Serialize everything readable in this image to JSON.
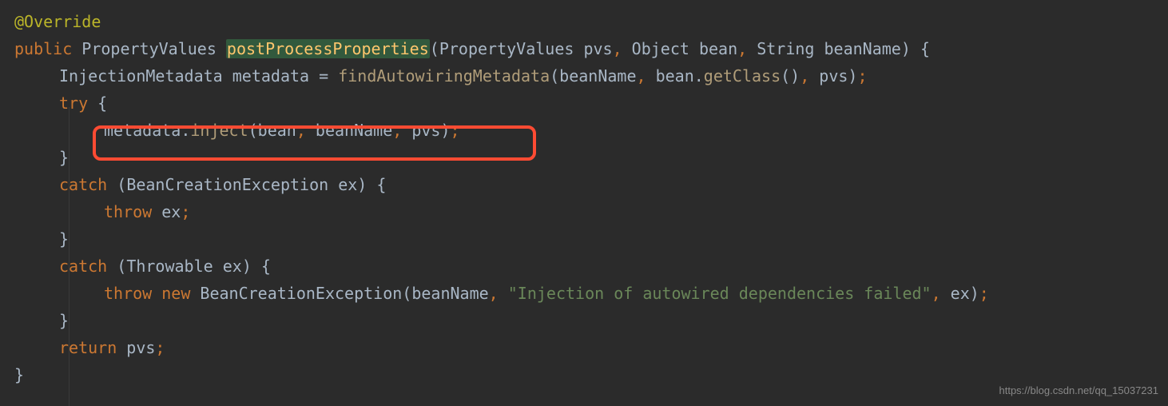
{
  "code": {
    "l1_annotation": "@Override",
    "l2_public": "public",
    "l2_type1": " PropertyValues ",
    "l2_method": "postProcessProperties",
    "l2_p1": "(",
    "l2_params": "PropertyValues pvs",
    "l2_c1": ",",
    "l2_params2": " Object bean",
    "l2_c2": ",",
    "l2_params3": " String beanName",
    "l2_p2": ")",
    "l2_brace": " {",
    "l3_a": "InjectionMetadata metadata = ",
    "l3_call": "findAutowiringMetadata",
    "l3_p1": "(",
    "l3_arg1": "beanName",
    "l3_c1": ",",
    "l3_arg2": " bean.",
    "l3_call2": "getClass",
    "l3_p2": "()",
    "l3_c2": ",",
    "l3_arg3": " pvs",
    "l3_p3": ")",
    "l3_semi": ";",
    "l4_try": "try",
    "l4_brace": " {",
    "l5_obj": "metadata.",
    "l5_call": "inject",
    "l5_p1": "(",
    "l5_arg1": "bean",
    "l5_c1": ",",
    "l5_arg2": " beanName",
    "l5_c2": ",",
    "l5_arg3": " pvs",
    "l5_p2": ")",
    "l5_semi": ";",
    "l6_brace": "}",
    "l7_catch": "catch",
    "l7_p1": " (",
    "l7_type": "BeanCreationException ex",
    "l7_p2": ")",
    "l7_brace": " {",
    "l8_throw": "throw",
    "l8_ex": " ex",
    "l8_semi": ";",
    "l9_brace": "}",
    "l10_catch": "catch",
    "l10_p1": " (",
    "l10_type": "Throwable ex",
    "l10_p2": ")",
    "l10_brace": " {",
    "l11_throw": "throw",
    "l11_new": " new",
    "l11_type": " BeanCreationException",
    "l11_p1": "(",
    "l11_arg1": "beanName",
    "l11_c1": ",",
    "l11_str": " \"Injection of autowired dependencies failed\"",
    "l11_c2": ",",
    "l11_arg2": " ex",
    "l11_p2": ")",
    "l11_semi": ";",
    "l12_brace": "}",
    "l13_return": "return",
    "l13_val": " pvs",
    "l13_semi": ";",
    "l14_brace": "}"
  },
  "watermark": "https://blog.csdn.net/qq_15037231"
}
